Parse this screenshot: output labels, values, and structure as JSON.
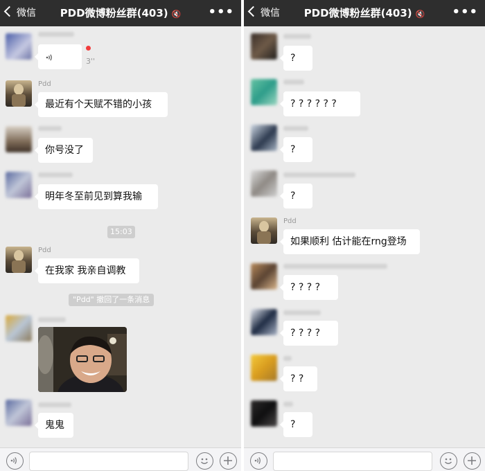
{
  "nav": {
    "back_label": "微信",
    "title": "PDD微博粉丝群(403)",
    "more": "•••"
  },
  "left_chat": {
    "voice_duration": "3''",
    "nick_pdd": "Pdd",
    "msg_1": "最近有个天赋不错的小孩",
    "msg_2": "你号没了",
    "msg_3": "明年冬至前见到算我输",
    "timestamp": "15:03",
    "msg_4": "在我家 我亲自调教",
    "recall_notice": "\"Pdd\" 撤回了一条消息",
    "msg_5": "鬼鬼"
  },
  "right_chat": {
    "nick_pdd": "Pdd",
    "msg_1": "?",
    "msg_2": "? ? ? ? ? ?",
    "msg_3": "?",
    "msg_4": "?",
    "msg_5": "如果顺利 估计能在rng登场",
    "msg_6": "? ? ? ?",
    "msg_7": "? ? ? ?",
    "msg_8": "? ?",
    "msg_9": "?"
  },
  "colors": {
    "nav_bg": "#2e2e2e",
    "chat_bg": "#ebebeb",
    "bubble": "#ffffff",
    "unread_dot": "#f23b3b"
  },
  "icons": [
    "chevron-left-icon",
    "mute-icon",
    "more-icon",
    "voice-icon",
    "emoji-icon",
    "plus-icon"
  ]
}
